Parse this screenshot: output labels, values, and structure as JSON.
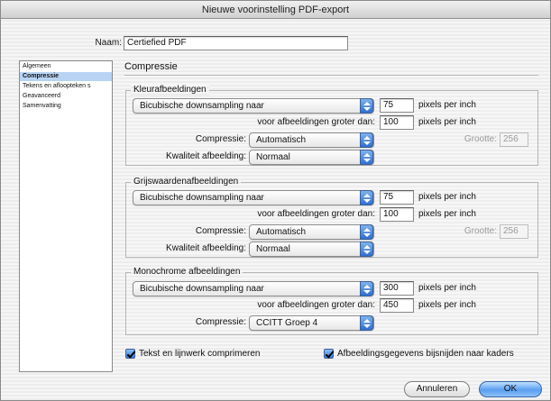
{
  "window": {
    "title": "Nieuwe voorinstelling PDF-export"
  },
  "name_field": {
    "label": "Naam:",
    "value": "Certiefied PDF"
  },
  "sidebar": {
    "items": [
      {
        "label": "Algemeen",
        "selected": false
      },
      {
        "label": "Compressie",
        "selected": true
      },
      {
        "label": "Tekens en afloopteken s",
        "selected": false
      },
      {
        "label": "Geavanceerd",
        "selected": false
      },
      {
        "label": "Samenvatting",
        "selected": false
      }
    ]
  },
  "panel": {
    "title": "Compressie"
  },
  "color_images": {
    "title": "Kleurafbeeldingen",
    "sampling": "Bicubische downsampling naar",
    "ppi": "75",
    "ppi_unit": "pixels per inch",
    "above_label": "voor afbeeldingen groter dan:",
    "above_value": "100",
    "above_unit": "pixels per inch",
    "compression_label": "Compressie:",
    "compression": "Automatisch",
    "size_label": "Grootte:",
    "size_value": "256",
    "quality_label": "Kwaliteit afbeelding:",
    "quality": "Normaal"
  },
  "gray_images": {
    "title": "Grijswaardenafbeeldingen",
    "sampling": "Bicubische downsampling naar",
    "ppi": "75",
    "ppi_unit": "pixels per inch",
    "above_label": "voor afbeeldingen groter dan:",
    "above_value": "100",
    "above_unit": "pixels per inch",
    "compression_label": "Compressie:",
    "compression": "Automatisch",
    "size_label": "Grootte:",
    "size_value": "256",
    "quality_label": "Kwaliteit afbeelding:",
    "quality": "Normaal"
  },
  "mono_images": {
    "title": "Monochrome afbeeldingen",
    "sampling": "Bicubische downsampling naar",
    "ppi": "300",
    "ppi_unit": "pixels per inch",
    "above_label": "voor afbeeldingen groter dan:",
    "above_value": "450",
    "above_unit": "pixels per inch",
    "compression_label": "Compressie:",
    "compression": "CCITT Groep 4"
  },
  "options": {
    "compress_text": "Tekst en lijnwerk comprimeren",
    "crop_images": "Afbeeldingsgegevens bijsnijden naar kaders"
  },
  "buttons": {
    "cancel": "Annuleren",
    "ok": "OK"
  },
  "colors": {
    "accent": "#3a79d6",
    "selection": "#b8d3f3"
  }
}
